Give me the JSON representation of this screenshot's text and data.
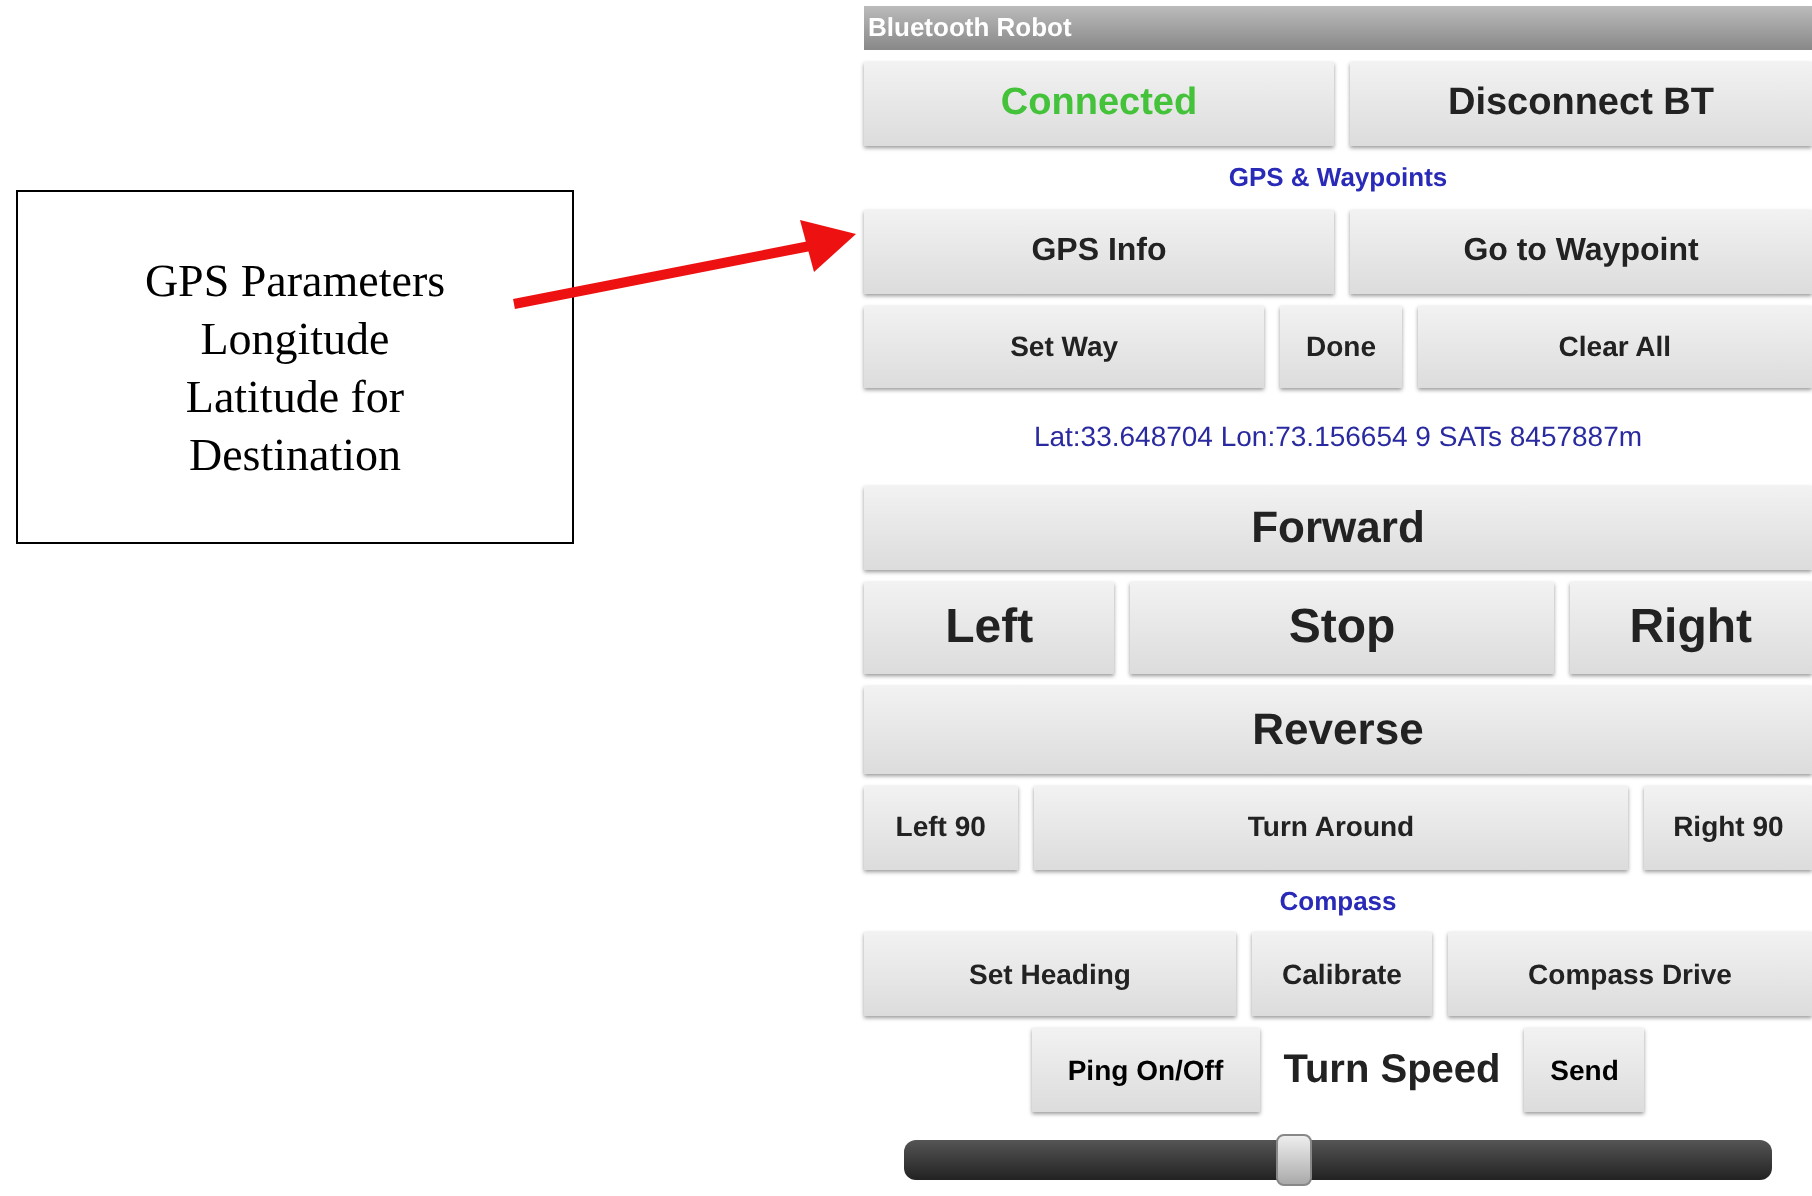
{
  "callout": {
    "lines": [
      "GPS Parameters",
      "Longitude",
      "Latitude for",
      "Destination"
    ]
  },
  "app": {
    "title": "Bluetooth Robot",
    "sections": [
      {
        "kind": "buttons",
        "buttons": [
          {
            "label": "Connected",
            "kind": "status"
          },
          {
            "label": "Disconnect BT",
            "kind": "button"
          }
        ]
      },
      {
        "kind": "heading",
        "text": "GPS & Waypoints"
      },
      {
        "kind": "buttons",
        "buttons": [
          {
            "label": "GPS Info",
            "kind": "button"
          },
          {
            "label": "Go to Waypoint",
            "kind": "button"
          }
        ]
      },
      {
        "kind": "buttons",
        "buttons": [
          {
            "label": "Set Way",
            "kind": "button"
          },
          {
            "label": "Done",
            "kind": "button"
          },
          {
            "label": "Clear All",
            "kind": "button"
          }
        ]
      },
      {
        "kind": "info",
        "text": "Lat:33.648704 Lon:73.156654 9 SATs 8457887m"
      },
      {
        "kind": "buttons",
        "buttons": [
          {
            "label": "Forward",
            "kind": "button"
          }
        ]
      },
      {
        "kind": "buttons",
        "buttons": [
          {
            "label": "Left",
            "kind": "button"
          },
          {
            "label": "Stop",
            "kind": "button"
          },
          {
            "label": "Right",
            "kind": "button"
          }
        ]
      },
      {
        "kind": "buttons",
        "buttons": [
          {
            "label": "Reverse",
            "kind": "button"
          }
        ]
      },
      {
        "kind": "buttons",
        "buttons": [
          {
            "label": "Left 90",
            "kind": "button"
          },
          {
            "label": "Turn Around",
            "kind": "button"
          },
          {
            "label": "Right 90",
            "kind": "button"
          }
        ]
      },
      {
        "kind": "heading",
        "text": "Compass"
      },
      {
        "kind": "buttons",
        "buttons": [
          {
            "label": "Set Heading",
            "kind": "button"
          },
          {
            "label": "Calibrate",
            "kind": "button"
          },
          {
            "label": "Compass  Drive",
            "kind": "button"
          }
        ]
      },
      {
        "kind": "speed",
        "ping": "Ping On/Off",
        "label": "Turn Speed",
        "send": "Send"
      },
      {
        "kind": "slider",
        "level": 0.45
      }
    ]
  }
}
